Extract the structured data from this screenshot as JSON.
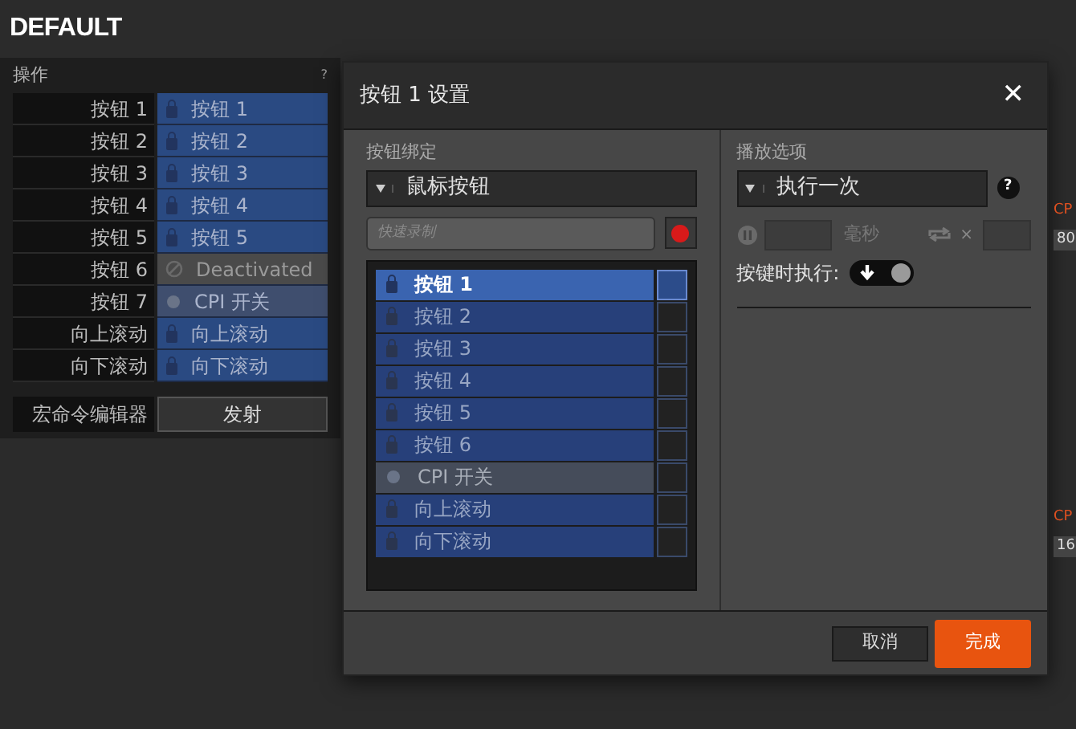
{
  "profile_title": "DEFAULT",
  "actions_panel": {
    "title": "操作",
    "help": "?",
    "rows": [
      {
        "button": "按钮 1",
        "action": "按钮 1",
        "kind": "button"
      },
      {
        "button": "按钮 2",
        "action": "按钮 2",
        "kind": "button"
      },
      {
        "button": "按钮 3",
        "action": "按钮 3",
        "kind": "button"
      },
      {
        "button": "按钮 4",
        "action": "按钮 4",
        "kind": "button"
      },
      {
        "button": "按钮 5",
        "action": "按钮 5",
        "kind": "button"
      },
      {
        "button": "按钮 6",
        "action": "Deactivated",
        "kind": "disabled"
      },
      {
        "button": "按钮 7",
        "action": "CPI 开关",
        "kind": "cpi"
      },
      {
        "button": "向上滚动",
        "action": "向上滚动",
        "kind": "button"
      },
      {
        "button": "向下滚动",
        "action": "向下滚动",
        "kind": "button"
      }
    ],
    "macro_label": "宏命令编辑器",
    "macro_button": "发射"
  },
  "dialog": {
    "title": "按钮 1 设置",
    "close": "✕",
    "binding": {
      "label": "按钮绑定",
      "dropdown": "鼠标按钮",
      "record_placeholder": "快速录制",
      "items": [
        {
          "label": "按钮 1",
          "kind": "button",
          "selected": true
        },
        {
          "label": "按钮 2",
          "kind": "button",
          "selected": false
        },
        {
          "label": "按钮 3",
          "kind": "button",
          "selected": false
        },
        {
          "label": "按钮 4",
          "kind": "button",
          "selected": false
        },
        {
          "label": "按钮 5",
          "kind": "button",
          "selected": false
        },
        {
          "label": "按钮 6",
          "kind": "button",
          "selected": false
        },
        {
          "label": "CPI 开关",
          "kind": "cpi",
          "selected": false
        },
        {
          "label": "向上滚动",
          "kind": "button",
          "selected": false
        },
        {
          "label": "向下滚动",
          "kind": "button",
          "selected": false
        }
      ]
    },
    "playback": {
      "label": "播放选项",
      "dropdown": "执行一次",
      "help": "?",
      "delay_unit": "毫秒",
      "repeat_times": "×",
      "on_press_label": "按键时执行:",
      "on_press": false
    },
    "buttons": {
      "cancel": "取消",
      "done": "完成"
    }
  },
  "right_edge": [
    {
      "label": "CP",
      "value": "80"
    },
    {
      "label": "CP",
      "value": "16"
    }
  ]
}
